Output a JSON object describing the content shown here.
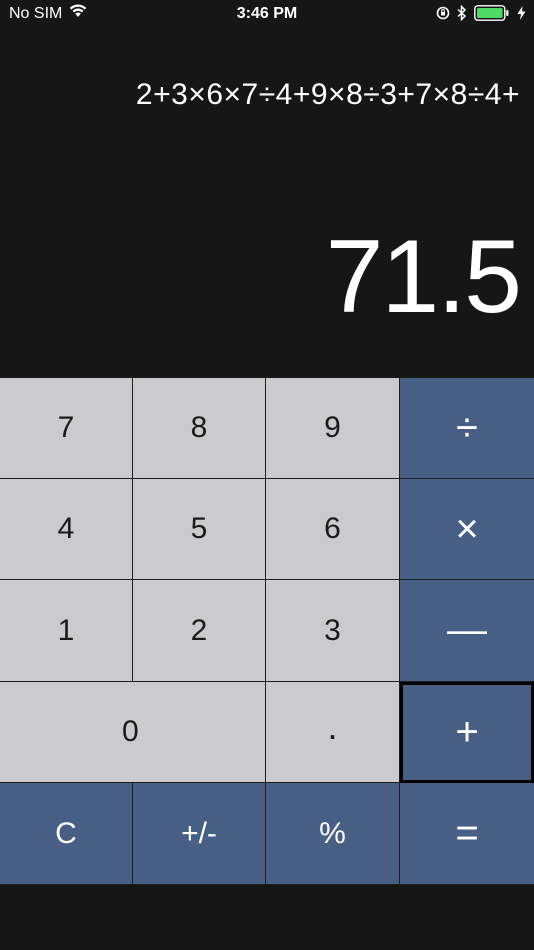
{
  "status_bar": {
    "carrier": "No SIM",
    "time": "3:46 PM",
    "battery_color": "#4cd964"
  },
  "display": {
    "expression": "2+3×6×7÷4+9×8÷3+7×8÷4+",
    "result": "71.5"
  },
  "keypad": {
    "row1": [
      "7",
      "8",
      "9",
      "÷"
    ],
    "row2": [
      "4",
      "5",
      "6",
      "×"
    ],
    "row3": [
      "1",
      "2",
      "3",
      "—"
    ],
    "row4": [
      "0",
      ".",
      "+"
    ],
    "row5": [
      "C",
      "+/-",
      "%",
      "="
    ],
    "selected_key": "+"
  },
  "colors": {
    "background": "#161616",
    "digit_key": "#cbcbcd",
    "function_key": "#475f84"
  }
}
